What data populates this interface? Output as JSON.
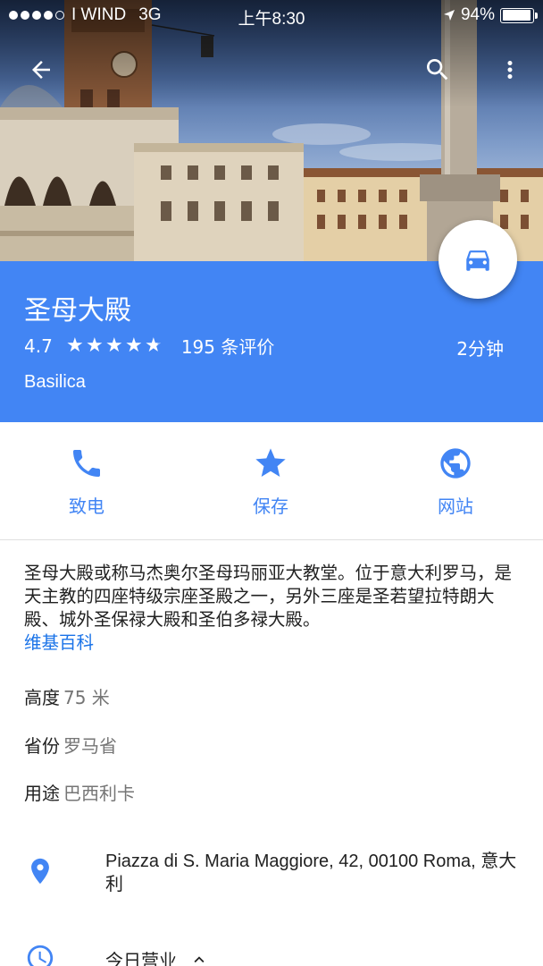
{
  "status_bar": {
    "carrier": "I WIND",
    "network": "3G",
    "time": "上午8:30",
    "battery": "94%",
    "battery_level": 0.94
  },
  "toolbar": {
    "back_icon": "arrow-back-icon",
    "search_icon": "search-icon",
    "more_icon": "more-vert-icon"
  },
  "place": {
    "name": "圣母大殿",
    "rating": "4.7",
    "rating_value": 4.7,
    "reviews": "195 条评价",
    "type": "Basilica",
    "travel_time": "2分钟",
    "travel_icon": "car-icon"
  },
  "actions": [
    {
      "label": "致电",
      "icon": "phone-icon"
    },
    {
      "label": "保存",
      "icon": "star-icon"
    },
    {
      "label": "网站",
      "icon": "globe-icon"
    }
  ],
  "description": {
    "text": "圣母大殿或称马杰奥尔圣母玛丽亚大教堂。位于意大利罗马，是天主教的四座特级宗座圣殿之一，另外三座是圣若望拉特朗大殿、城外圣保禄大殿和圣伯多禄大殿。",
    "source": "维基百科"
  },
  "facts": [
    {
      "label": "高度",
      "value": "75 米"
    },
    {
      "label": "省份",
      "value": "罗马省"
    },
    {
      "label": "用途",
      "value": "巴西利卡"
    }
  ],
  "address": {
    "text": "Piazza di S. Maria Maggiore, 42, 00100 Roma, 意大利",
    "icon": "location-pin-icon"
  },
  "hours": {
    "label": "今日营业",
    "icon": "clock-icon"
  },
  "colors": {
    "accent": "#4285f4",
    "text": "#212121",
    "secondary": "#757575"
  }
}
